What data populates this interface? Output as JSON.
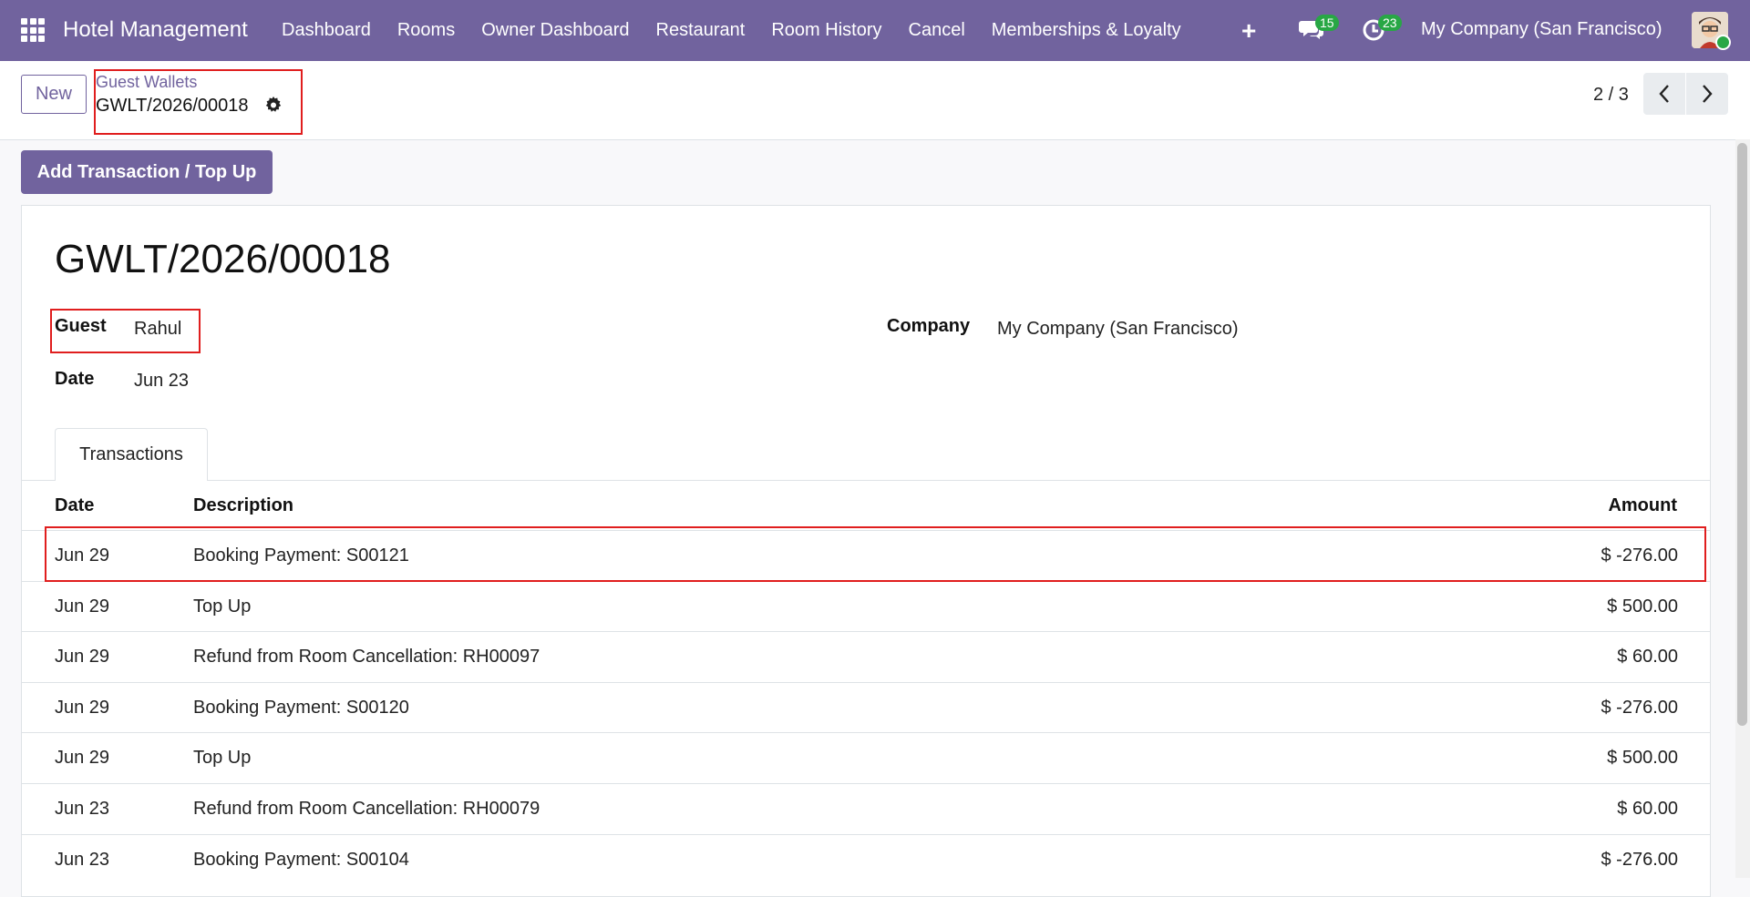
{
  "navbar": {
    "app_title": "Hotel Management",
    "menu": [
      "Dashboard",
      "Rooms",
      "Owner Dashboard",
      "Restaurant",
      "Room History",
      "Cancel",
      "Memberships & Loyalty"
    ],
    "messages_count": "15",
    "activities_count": "23",
    "company": "My Company (San Francisco)"
  },
  "control_panel": {
    "new_label": "New",
    "breadcrumb_parent": "Guest Wallets",
    "breadcrumb_current": "GWLT/2026/00018",
    "pager": "2 / 3"
  },
  "actions": {
    "add_transaction": "Add Transaction / Top Up"
  },
  "form": {
    "title": "GWLT/2026/00018",
    "guest_label": "Guest",
    "guest_value": "Rahul",
    "date_label": "Date",
    "date_value": "Jun 23",
    "company_label": "Company",
    "company_value": "My Company (San Francisco)"
  },
  "tabs": {
    "transactions": "Transactions"
  },
  "table": {
    "headers": {
      "date": "Date",
      "description": "Description",
      "amount": "Amount"
    },
    "rows": [
      {
        "date": "Jun 29",
        "description": "Booking Payment: S00121",
        "amount": "$ -276.00"
      },
      {
        "date": "Jun 29",
        "description": "Top Up",
        "amount": "$ 500.00"
      },
      {
        "date": "Jun 29",
        "description": "Refund from Room Cancellation: RH00097",
        "amount": "$ 60.00"
      },
      {
        "date": "Jun 29",
        "description": "Booking Payment: S00120",
        "amount": "$ -276.00"
      },
      {
        "date": "Jun 29",
        "description": "Top Up",
        "amount": "$ 500.00"
      },
      {
        "date": "Jun 23",
        "description": "Refund from Room Cancellation: RH00079",
        "amount": "$ 60.00"
      },
      {
        "date": "Jun 23",
        "description": "Booking Payment: S00104",
        "amount": "$ -276.00"
      }
    ]
  },
  "colors": {
    "brand": "#71639e",
    "badge": "#28a745",
    "highlight": "#e01e1e"
  }
}
